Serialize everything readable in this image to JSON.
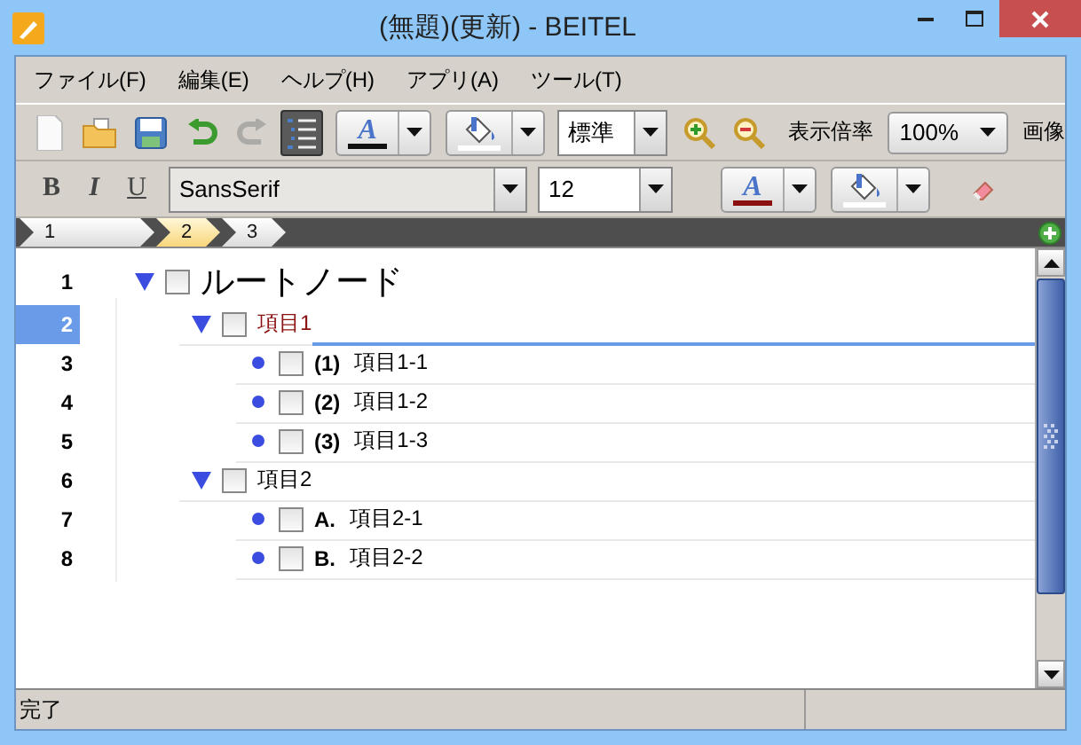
{
  "window": {
    "title": "(無題)(更新) - BEITEL"
  },
  "menu": [
    "ファイル(F)",
    "編集(E)",
    "ヘルプ(H)",
    "アプリ(A)",
    "ツール(T)"
  ],
  "toolbar": {
    "tools": [
      {
        "kind": "new",
        "disabled": false,
        "pressed": false
      },
      {
        "kind": "open",
        "disabled": false,
        "pressed": false
      },
      {
        "kind": "save",
        "disabled": false,
        "pressed": false
      },
      {
        "kind": "undo",
        "disabled": false,
        "pressed": false
      },
      {
        "kind": "redo",
        "disabled": true,
        "pressed": false
      },
      {
        "kind": "outline",
        "disabled": false,
        "pressed": true
      }
    ],
    "font_color_glyph": "A",
    "style": "標準",
    "zoom_label": "表示倍率",
    "zoom": "100%",
    "cut_label": "画像"
  },
  "format_bar": {
    "bold": "B",
    "italic": "I",
    "underline": "U",
    "font": "SansSerif",
    "size": "12",
    "font_color_glyph": "A"
  },
  "tabs": [
    {
      "label": "1",
      "selected": false
    },
    {
      "label": "2",
      "selected": true
    },
    {
      "label": "3",
      "selected": false
    }
  ],
  "outline": [
    {
      "line": "1",
      "kind": "branch",
      "expanded": true,
      "checked": false,
      "text": "ルートノード",
      "selected": false,
      "children": [
        {
          "line": "2",
          "kind": "branch",
          "expanded": true,
          "checked": false,
          "text": "項目1",
          "selected": true,
          "children": [
            {
              "line": "3",
              "kind": "leaf",
              "checked": false,
              "prefix": "(1)",
              "text": "項目1-1",
              "selected": false
            },
            {
              "line": "4",
              "kind": "leaf",
              "checked": false,
              "prefix": "(2)",
              "text": "項目1-2",
              "selected": false
            },
            {
              "line": "5",
              "kind": "leaf",
              "checked": false,
              "prefix": "(3)",
              "text": "項目1-3",
              "selected": false
            }
          ]
        },
        {
          "line": "6",
          "kind": "branch",
          "expanded": true,
          "checked": false,
          "text": "項目2",
          "selected": false,
          "children": [
            {
              "line": "7",
              "kind": "leaf",
              "checked": false,
              "prefix": "A.",
              "text": "項目2-1",
              "selected": false
            },
            {
              "line": "8",
              "kind": "leaf",
              "checked": false,
              "prefix": "B.",
              "text": "項目2-2",
              "selected": false
            }
          ]
        }
      ]
    }
  ],
  "status_bar": {
    "text": "完了"
  }
}
